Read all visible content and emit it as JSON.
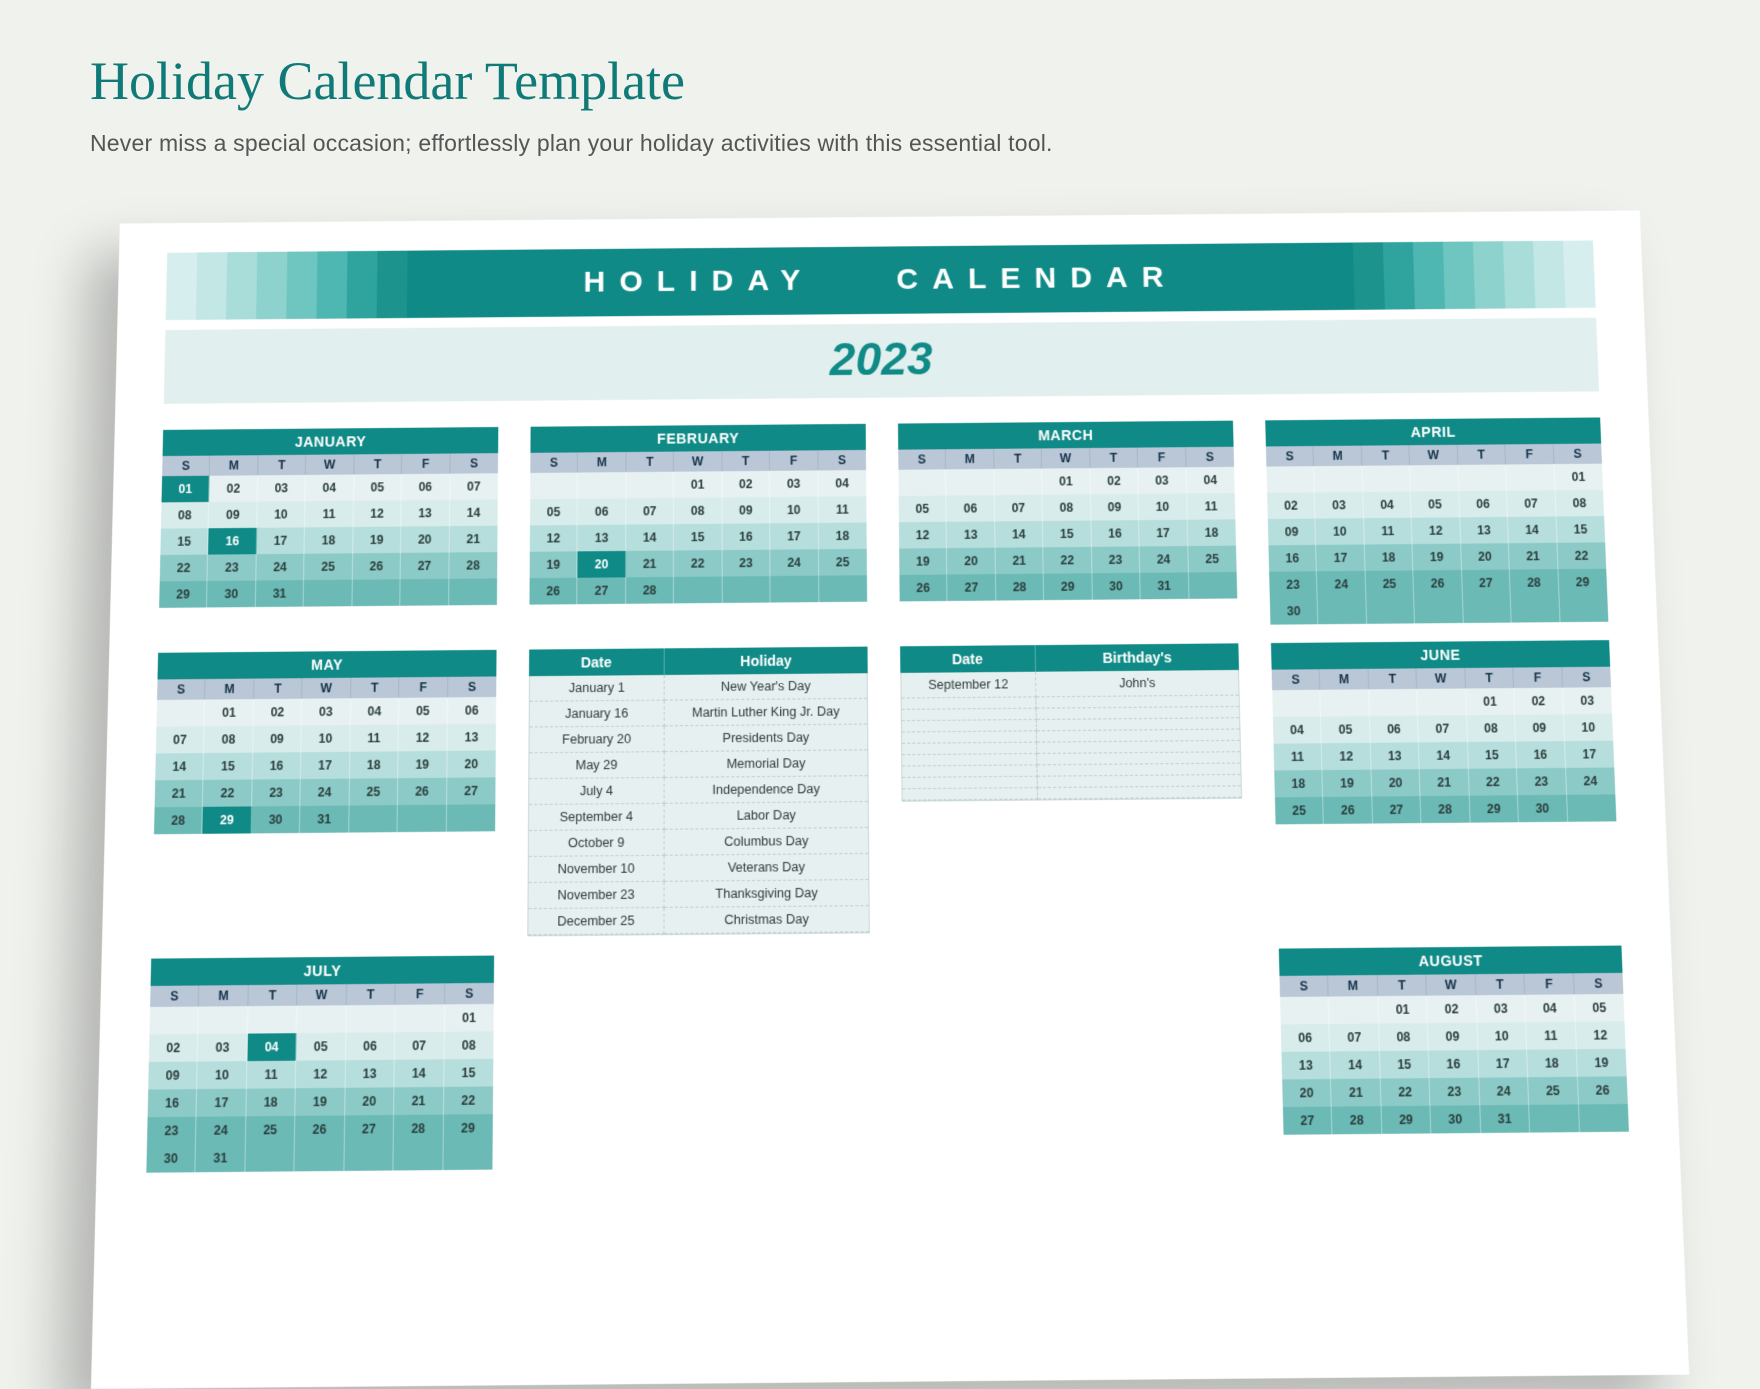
{
  "page_title": "Holiday Calendar Template",
  "subtitle": "Never miss a special occasion; effortlessly plan your holiday activities with this essential tool.",
  "banner_text": "HOLIDAY CALENDAR",
  "year": "2023",
  "dow": [
    "S",
    "M",
    "T",
    "W",
    "T",
    "F",
    "S"
  ],
  "fade_colors": [
    "#d6efee",
    "#c2e7e5",
    "#a8ddd9",
    "#8dd2cd",
    "#6fc6c0",
    "#4fb7b1",
    "#2fa39d",
    "#1c938d"
  ],
  "months": [
    {
      "name": "JANUARY",
      "start": 0,
      "days": 31,
      "highlight": [
        1,
        16
      ]
    },
    {
      "name": "FEBRUARY",
      "start": 3,
      "days": 28,
      "highlight": [
        20
      ]
    },
    {
      "name": "MARCH",
      "start": 3,
      "days": 31,
      "highlight": []
    },
    {
      "name": "APRIL",
      "start": 6,
      "days": 30,
      "highlight": []
    },
    {
      "name": "MAY",
      "start": 1,
      "days": 31,
      "highlight": [
        29
      ]
    },
    {
      "name": "JUNE",
      "start": 4,
      "days": 30,
      "highlight": []
    },
    {
      "name": "JULY",
      "start": 6,
      "days": 31,
      "highlight": [
        4
      ]
    },
    {
      "name": "AUGUST",
      "start": 2,
      "days": 31,
      "highlight": []
    }
  ],
  "holiday_table": {
    "head": [
      "Date",
      "Holiday"
    ],
    "rows": [
      [
        "January 1",
        "New Year's Day"
      ],
      [
        "January 16",
        "Martin Luther King Jr. Day"
      ],
      [
        "February 20",
        "Presidents Day"
      ],
      [
        "May 29",
        "Memorial Day"
      ],
      [
        "July 4",
        "Independence Day"
      ],
      [
        "September 4",
        "Labor Day"
      ],
      [
        "October 9",
        "Columbus Day"
      ],
      [
        "November 10",
        "Veterans Day"
      ],
      [
        "November 23",
        "Thanksgiving Day"
      ],
      [
        "December 25",
        "Christmas Day"
      ]
    ]
  },
  "birthday_table": {
    "head": [
      "Date",
      "Birthday's"
    ],
    "rows": [
      [
        "September 12",
        "John's"
      ],
      [
        "",
        ""
      ],
      [
        "",
        ""
      ],
      [
        "",
        ""
      ],
      [
        "",
        ""
      ],
      [
        "",
        ""
      ],
      [
        "",
        ""
      ],
      [
        "",
        ""
      ],
      [
        "",
        ""
      ],
      [
        "",
        ""
      ]
    ]
  },
  "row2_layout": [
    "MAY",
    "__holidays__",
    "__birthdays__",
    "JUNE"
  ],
  "row3_layout": [
    "JULY",
    null,
    null,
    "AUGUST"
  ]
}
